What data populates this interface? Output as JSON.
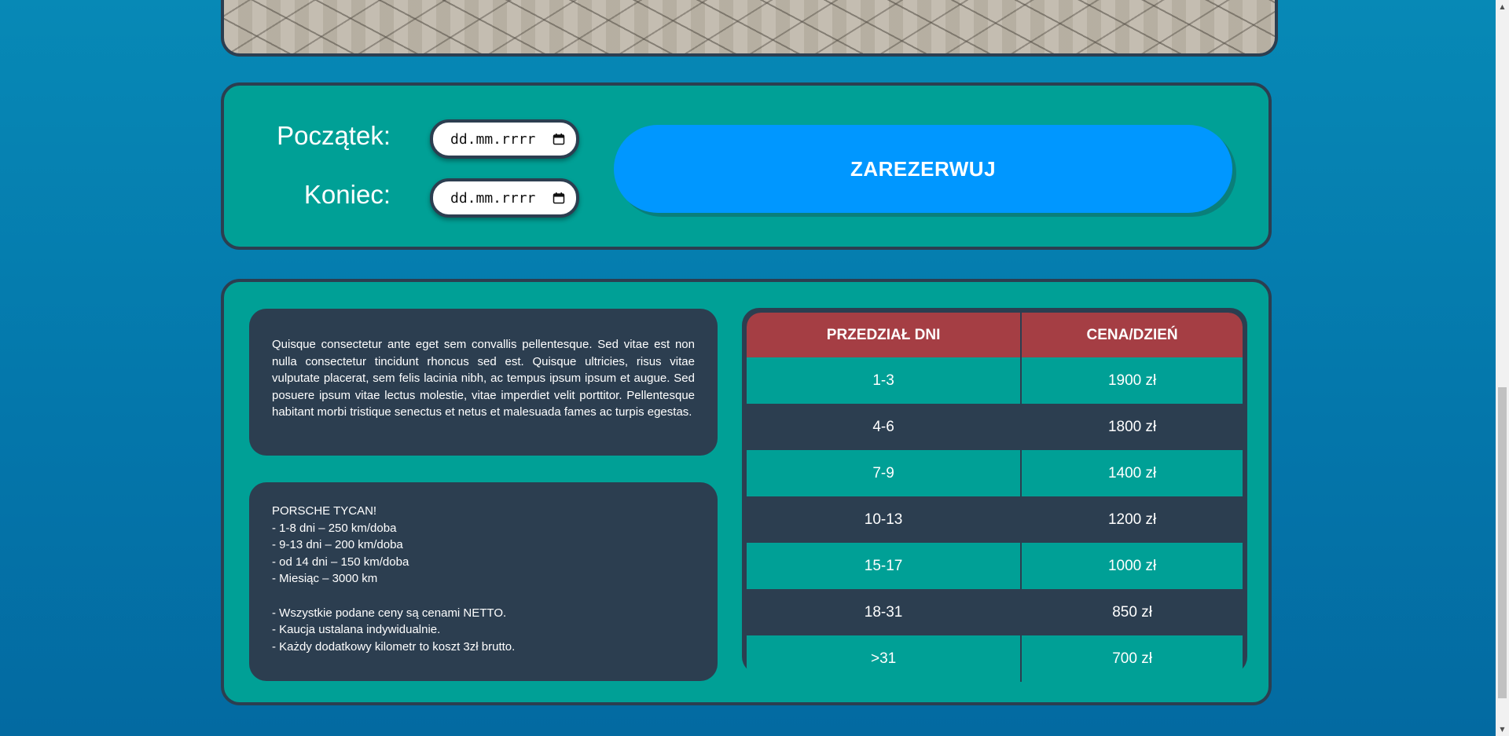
{
  "reservation": {
    "start_label": "Początek:",
    "end_label": "Koniec:",
    "start_placeholder": "dd.mm.rrrr",
    "end_placeholder": "dd.mm.rrrr",
    "reserve_button": "ZAREZERWUJ"
  },
  "description": "Quisque consectetur ante eget sem convallis pellentesque. Sed vitae est non nulla consectetur tincidunt rhoncus sed est. Quisque ultricies, risus vitae vulputate placerat, sem felis lacinia nibh, ac tempus ipsum ipsum et augue. Sed posuere ipsum vitae lectus molestie, vitae imperdiet velit porttitor. Pellentesque habitant morbi tristique senectus et netus et malesuada fames ac turpis egestas.",
  "rules": [
    "PORSCHE TYCAN!",
    "- 1-8 dni – 250 km/doba",
    "- 9-13 dni – 200 km/doba",
    "- od 14 dni – 150 km/doba",
    "- Miesiąc – 3000 km",
    "",
    "- Wszystkie podane ceny są cenami NETTO.",
    "- Kaucja ustalana indywidualnie.",
    "- Każdy dodatkowy kilometr to koszt 3zł brutto."
  ],
  "price_table": {
    "headers": [
      "PRZEDZIAŁ DNI",
      "CENA/DZIEŃ"
    ],
    "rows": [
      {
        "range": "1-3",
        "price": "1900 zł"
      },
      {
        "range": "4-6",
        "price": "1800 zł"
      },
      {
        "range": "7-9",
        "price": "1400 zł"
      },
      {
        "range": "10-13",
        "price": "1200 zł"
      },
      {
        "range": "15-17",
        "price": "1000 zł"
      },
      {
        "range": "18-31",
        "price": "850 zł"
      },
      {
        "range": ">31",
        "price": "700 zł"
      }
    ]
  },
  "colors": {
    "panel": "#00a096",
    "dark": "#2c3e50",
    "accent": "#0097ff",
    "header": "#a53e44"
  },
  "icons": {
    "date_picker": "calendar-icon"
  }
}
